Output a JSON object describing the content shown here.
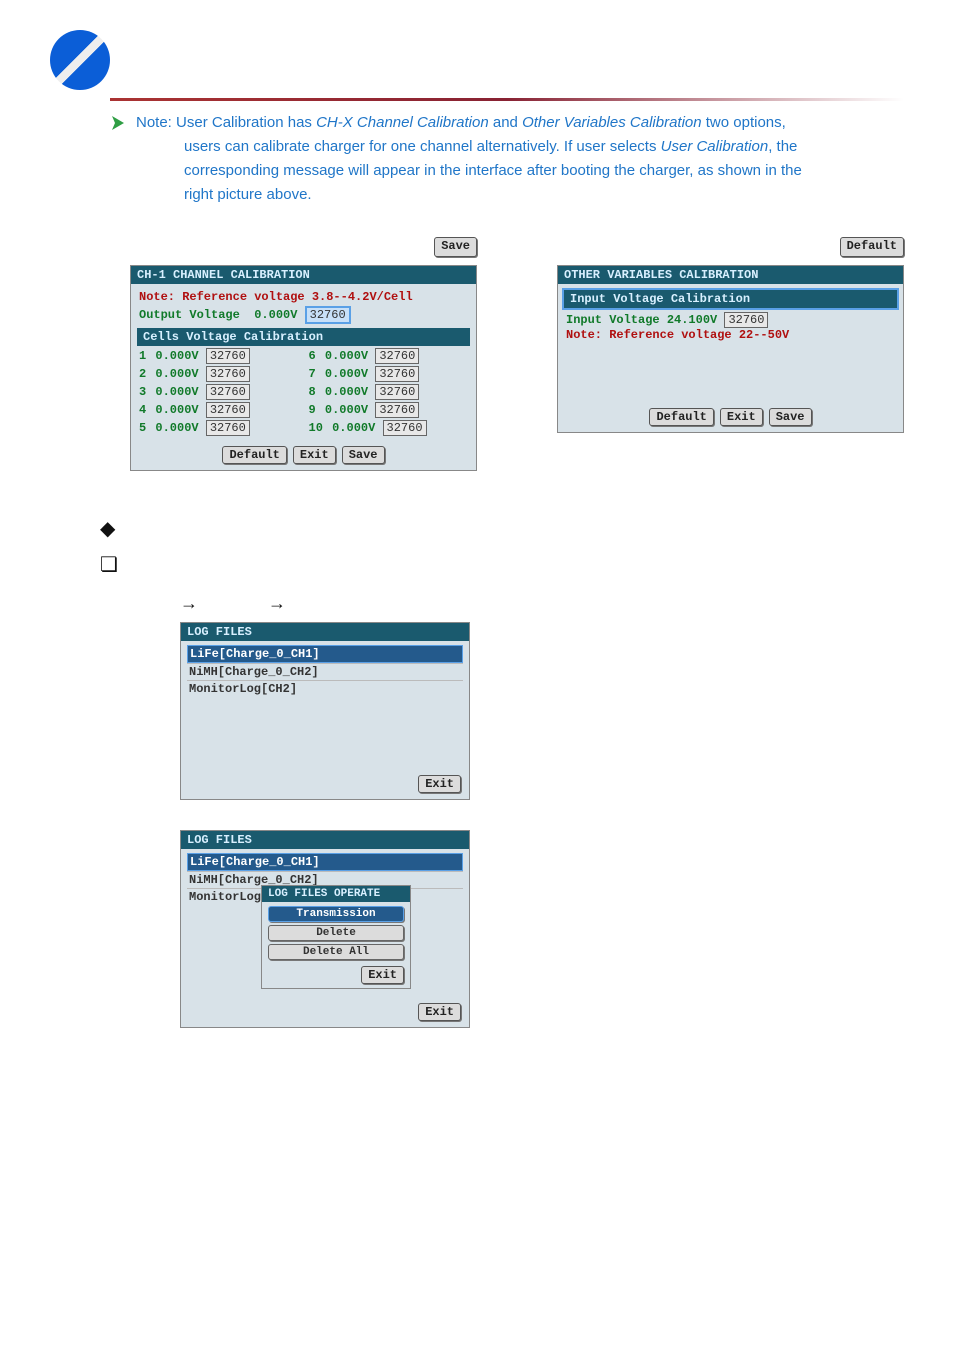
{
  "note": {
    "prefix": "Note:",
    "text1a": "User Calibration has ",
    "link1": "CH-X Channel Calibration",
    "text1b": " and ",
    "link2": "Other Variables Calibration",
    "text1c": " two options,",
    "text2a": "users can calibrate charger for one channel alternatively. If user selects ",
    "link3": "User Calibration",
    "text2b": ", the",
    "text3": "corresponding message will appear in the interface after booting the charger, as shown in the",
    "text4": "right picture above."
  },
  "btn": {
    "save": "Save",
    "default": "Default",
    "exit": "Exit"
  },
  "ch1": {
    "title": "CH-1 CHANNEL CALIBRATION",
    "note": "Note: Reference voltage 3.8--4.2V/Cell",
    "outlabel": "Output Voltage",
    "outval": "0.000V",
    "outcode": "32760",
    "cellslabel": "Cells Voltage Calibration",
    "rows": [
      {
        "i": "1",
        "v": "0.000V",
        "c": "32760"
      },
      {
        "i": "2",
        "v": "0.000V",
        "c": "32760"
      },
      {
        "i": "3",
        "v": "0.000V",
        "c": "32760"
      },
      {
        "i": "4",
        "v": "0.000V",
        "c": "32760"
      },
      {
        "i": "5",
        "v": "0.000V",
        "c": "32760"
      },
      {
        "i": "6",
        "v": "0.000V",
        "c": "32760"
      },
      {
        "i": "7",
        "v": "0.000V",
        "c": "32760"
      },
      {
        "i": "8",
        "v": "0.000V",
        "c": "32760"
      },
      {
        "i": "9",
        "v": "0.000V",
        "c": "32760"
      },
      {
        "i": "10",
        "v": "0.000V",
        "c": "32760"
      }
    ]
  },
  "other": {
    "title": "OTHER VARIABLES CALIBRATION",
    "sec": "Input Voltage Calibration",
    "row": "Input Voltage 24.100V",
    "code": "32760",
    "note": "Note: Reference voltage 22--50V"
  },
  "arrows": {
    "a": "→",
    "b": "→"
  },
  "log1": {
    "title": "LOG FILES",
    "items": [
      "LiFe[Charge_0_CH1]",
      "NiMH[Charge_0_CH2]",
      "MonitorLog[CH2]"
    ]
  },
  "log2": {
    "title": "LOG FILES",
    "items": [
      "LiFe[Charge_0_CH1]",
      "NiMH[Charge_0_CH2]",
      "MonitorLog[CH2]"
    ],
    "popup": {
      "title": "LOG FILES OPERATE",
      "items": [
        "Transmission",
        "Delete",
        "Delete All"
      ],
      "exit": "Exit"
    }
  }
}
